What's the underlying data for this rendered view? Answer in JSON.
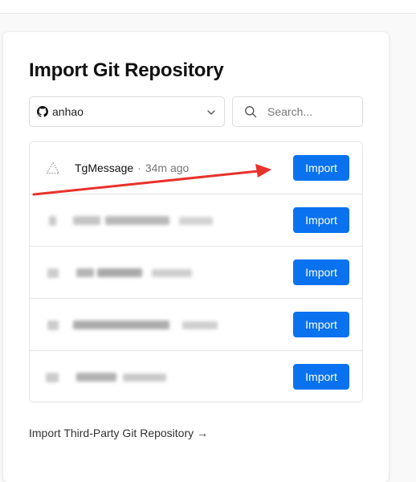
{
  "title": "Import Git Repository",
  "account": {
    "name": "anhao",
    "icon": "github-icon"
  },
  "search": {
    "placeholder": "Search...",
    "value": ""
  },
  "repos": [
    {
      "name": "TgMessage",
      "separator": "·",
      "updated": "34m ago",
      "import_label": "Import",
      "obscured": false
    },
    {
      "name": "",
      "separator": "",
      "updated": "",
      "import_label": "Import",
      "obscured": true
    },
    {
      "name": "",
      "separator": "",
      "updated": "",
      "import_label": "Import",
      "obscured": true
    },
    {
      "name": "",
      "separator": "",
      "updated": "",
      "import_label": "Import",
      "obscured": true
    },
    {
      "name": "",
      "separator": "",
      "updated": "",
      "import_label": "Import",
      "obscured": true
    }
  ],
  "third_party_link": "Import Third-Party Git Repository →",
  "colors": {
    "primary_button": "#0a72ef",
    "annotation_arrow": "#e8322b",
    "border": "#e5e5e5"
  }
}
